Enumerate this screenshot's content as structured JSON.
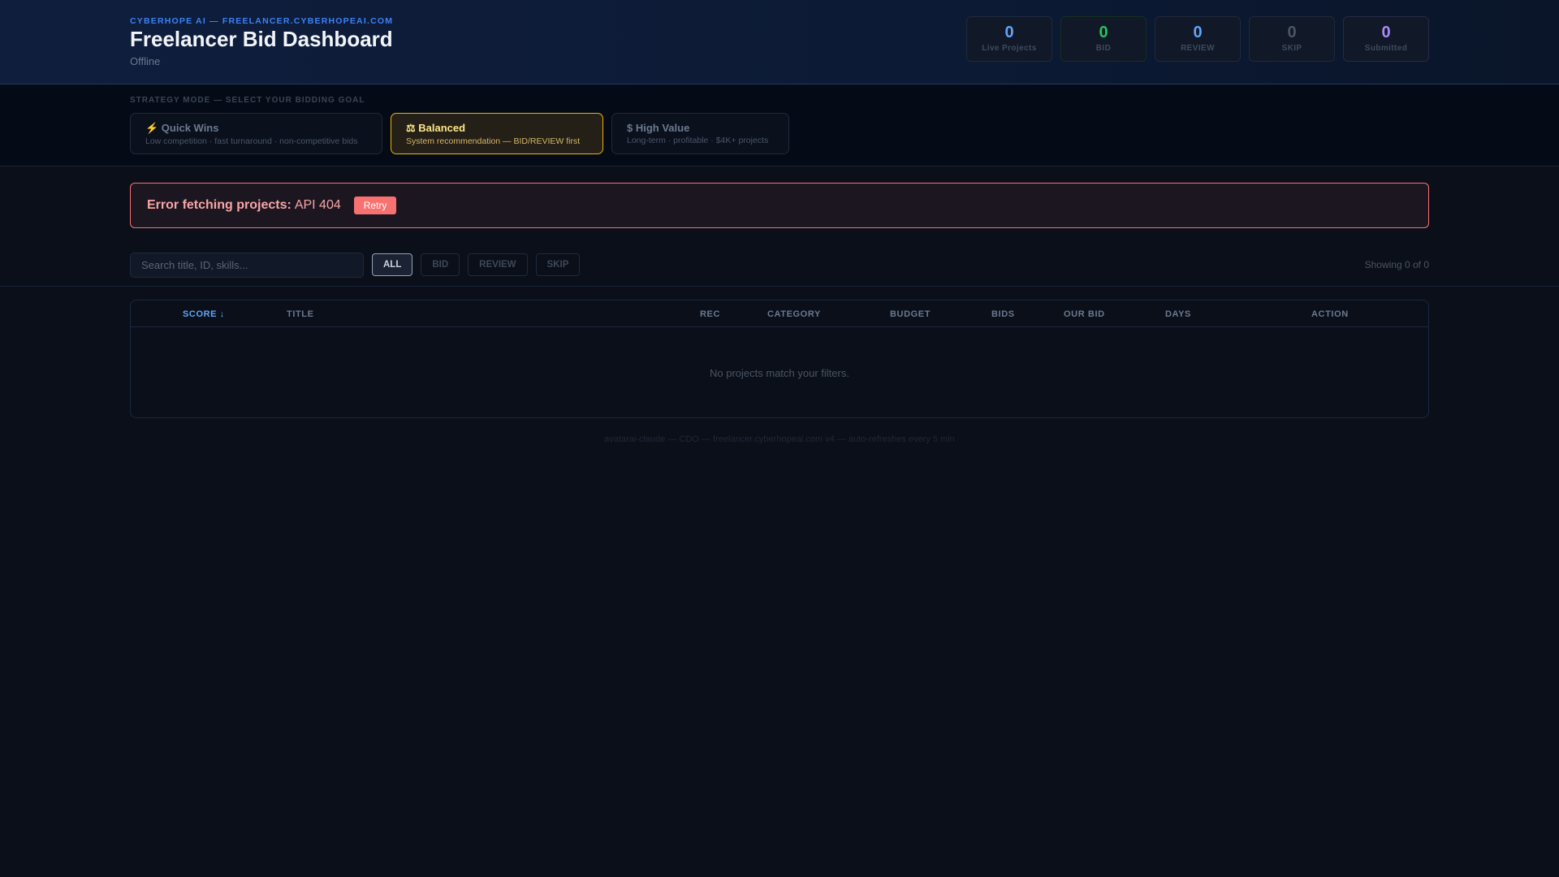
{
  "header": {
    "brand": "CYBERHOPE AI — FREELANCER.CYBERHOPEAI.COM",
    "title": "Freelancer Bid Dashboard",
    "status": "Offline"
  },
  "stats": [
    {
      "value": "0",
      "label": "Live Projects",
      "color": "#60a5fa"
    },
    {
      "value": "0",
      "label": "BID",
      "color": "#22c55e"
    },
    {
      "value": "0",
      "label": "REVIEW",
      "color": "#60a5fa"
    },
    {
      "value": "0",
      "label": "SKIP",
      "color": "#4b5563"
    },
    {
      "value": "0",
      "label": "Submitted",
      "color": "#a78bfa"
    }
  ],
  "strategy": {
    "label": "STRATEGY MODE — SELECT YOUR BIDDING GOAL",
    "modes": [
      {
        "name": "⚡ Quick Wins",
        "desc": "Low competition · fast turnaround · non-competitive bids"
      },
      {
        "name": "⚖ Balanced",
        "desc": "System recommendation — BID/REVIEW first"
      },
      {
        "name": "$ High Value",
        "desc": "Long-term · profitable · $4K+ projects"
      }
    ],
    "active": "Balanced"
  },
  "error": {
    "bold": "Error fetching projects:",
    "message": "API 404",
    "retry": "Retry"
  },
  "filters": {
    "search_placeholder": "Search title, ID, skills...",
    "search_value": "",
    "buttons": [
      "ALL",
      "BID",
      "REVIEW",
      "SKIP"
    ],
    "active": "ALL",
    "showing": "Showing 0 of 0"
  },
  "table": {
    "columns": [
      "SCORE ↓",
      "TITLE",
      "REC",
      "CATEGORY",
      "BUDGET",
      "BIDS",
      "OUR BID",
      "DAYS",
      "ACTION"
    ],
    "empty": "No projects match your filters."
  },
  "footer": "avatarai-claude — CDO — freelancer.cyberhopeai.com v4 — auto-refreshes every 5 min"
}
